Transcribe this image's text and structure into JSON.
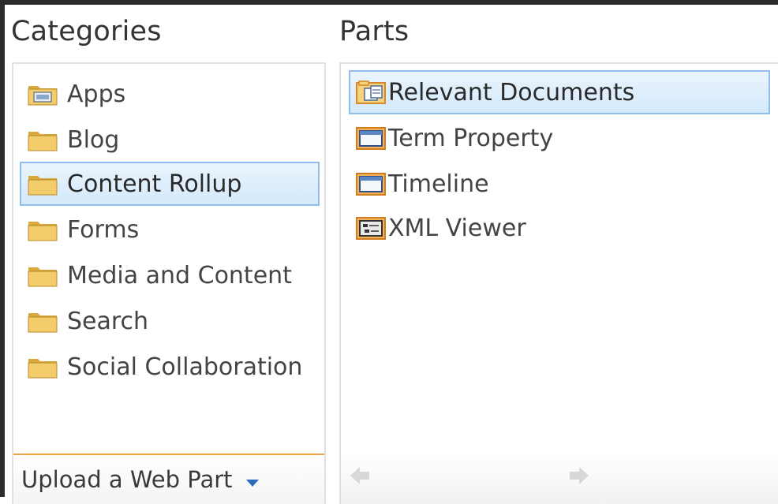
{
  "categories": {
    "heading": "Categories",
    "items": [
      {
        "label": "Apps",
        "icon": "folder-apps-icon"
      },
      {
        "label": "Blog",
        "icon": "folder-icon"
      },
      {
        "label": "Content Rollup",
        "icon": "folder-icon",
        "selected": true
      },
      {
        "label": "Forms",
        "icon": "folder-icon"
      },
      {
        "label": "Media and Content",
        "icon": "folder-icon"
      },
      {
        "label": "Search",
        "icon": "folder-icon"
      },
      {
        "label": "Social Collaboration",
        "icon": "folder-icon"
      }
    ],
    "upload_label": "Upload a Web Part"
  },
  "parts": {
    "heading": "Parts",
    "items": [
      {
        "label": "Relevant Documents",
        "icon": "relevant-documents-icon",
        "selected": true
      },
      {
        "label": "Term Property",
        "icon": "web-part-icon"
      },
      {
        "label": "Timeline",
        "icon": "web-part-icon"
      },
      {
        "label": "XML Viewer",
        "icon": "xml-viewer-icon"
      }
    ]
  },
  "colors": {
    "selection_border": "#8fbeeb",
    "selection_fill": "#dcecfc",
    "upload_accent": "#f2a03d",
    "folder": "#f0c45a"
  }
}
